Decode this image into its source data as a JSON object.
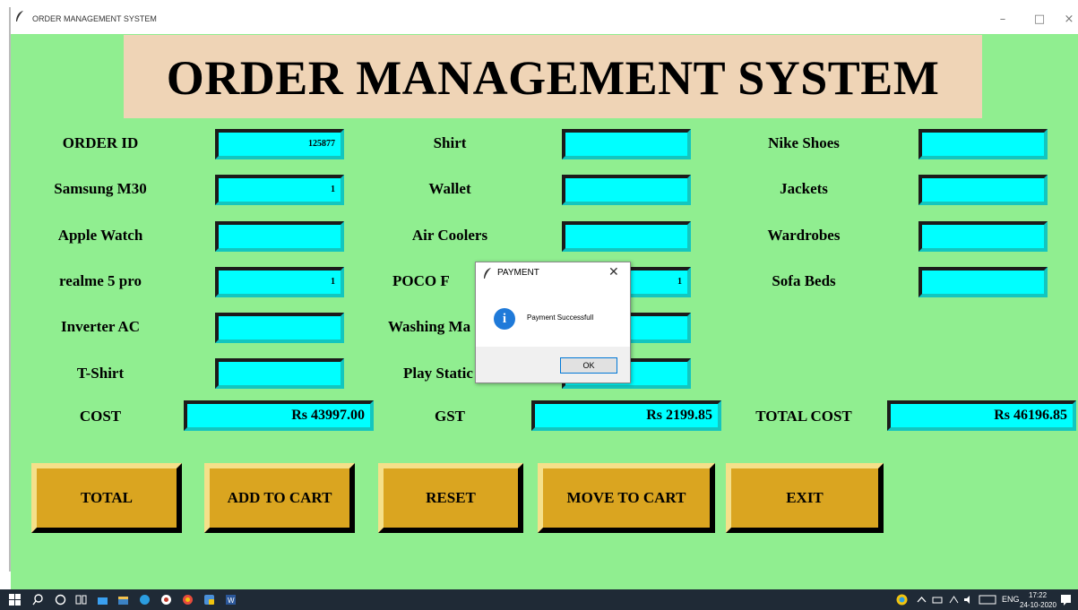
{
  "window": {
    "title": "ORDER MANAGEMENT SYSTEM",
    "minimize": "–",
    "maximize": "□",
    "close": "×"
  },
  "banner": {
    "title": "ORDER MANAGEMENT SYSTEM"
  },
  "col1": [
    {
      "label": "ORDER ID",
      "value": "125877"
    },
    {
      "label": "Samsung M30",
      "value": "1"
    },
    {
      "label": "Apple Watch",
      "value": ""
    },
    {
      "label": "realme 5 pro",
      "value": "1"
    },
    {
      "label": "Inverter AC",
      "value": ""
    },
    {
      "label": "T-Shirt",
      "value": ""
    }
  ],
  "col2": [
    {
      "label": "Shirt",
      "value": ""
    },
    {
      "label": "Wallet",
      "value": ""
    },
    {
      "label": "Air Coolers",
      "value": ""
    },
    {
      "label": "POCO F",
      "value": "1"
    },
    {
      "label": "Washing Ma",
      "value": ""
    },
    {
      "label": "Play Static",
      "value": ""
    }
  ],
  "col3": [
    {
      "label": "Nike Shoes",
      "value": ""
    },
    {
      "label": "Jackets",
      "value": ""
    },
    {
      "label": "Wardrobes",
      "value": ""
    },
    {
      "label": "Sofa Beds",
      "value": ""
    }
  ],
  "totals": {
    "cost_label": "COST",
    "cost_value": "Rs 43997.00",
    "gst_label": "GST",
    "gst_value": "Rs 2199.85",
    "total_label": "TOTAL COST",
    "total_value": "Rs 46196.85"
  },
  "buttons": {
    "total": "TOTAL",
    "add": "ADD TO CART",
    "reset": "RESET",
    "move": "MOVE TO CART",
    "exit": "EXIT"
  },
  "dialog": {
    "title": "PAYMENT",
    "close": "✕",
    "icon": "i",
    "message": "Payment Successfull",
    "ok": "OK"
  },
  "taskbar": {
    "lang": "ENG",
    "time": "17:22",
    "date": "24-10-2020"
  },
  "colors": {
    "background": "#90ee90",
    "banner": "#efd4b6",
    "field": "#00ffff",
    "button": "#daa520"
  }
}
